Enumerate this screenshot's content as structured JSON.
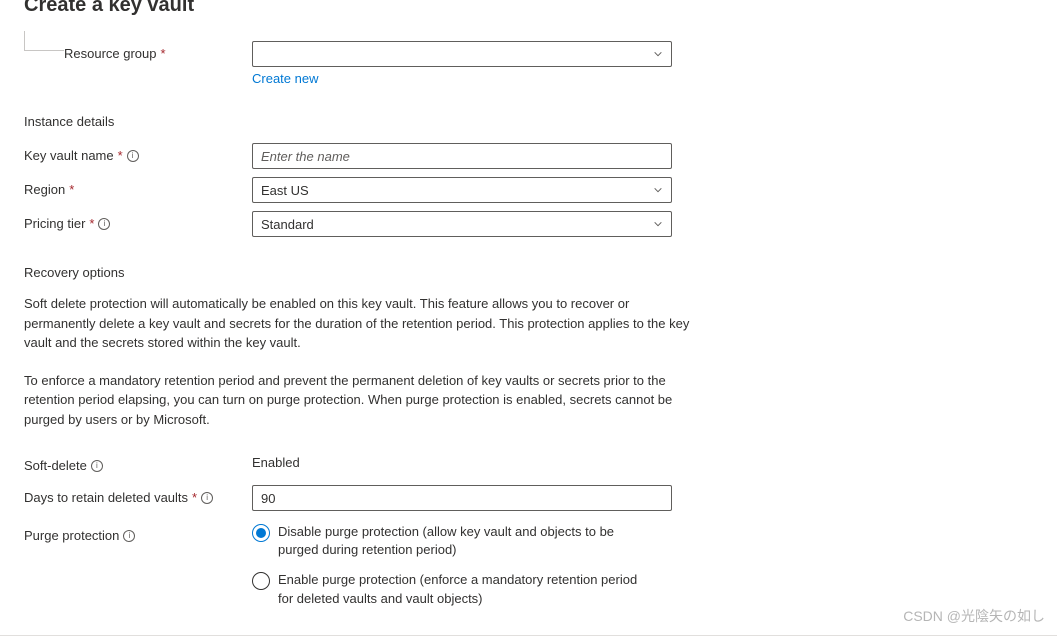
{
  "page": {
    "title": "Create a key vault"
  },
  "resourceGroup": {
    "label": "Resource group",
    "value": "",
    "createNewLink": "Create new"
  },
  "instanceDetails": {
    "heading": "Instance details",
    "keyVaultName": {
      "label": "Key vault name",
      "placeholder": "Enter the name",
      "value": ""
    },
    "region": {
      "label": "Region",
      "value": "East US"
    },
    "pricingTier": {
      "label": "Pricing tier",
      "value": "Standard"
    }
  },
  "recoveryOptions": {
    "heading": "Recovery options",
    "desc1": "Soft delete protection will automatically be enabled on this key vault. This feature allows you to recover or permanently delete a key vault and secrets for the duration of the retention period. This protection applies to the key vault and the secrets stored within the key vault.",
    "desc2": "To enforce a mandatory retention period and prevent the permanent deletion of key vaults or secrets prior to the retention period elapsing, you can turn on purge protection. When purge protection is enabled, secrets cannot be purged by users or by Microsoft.",
    "softDelete": {
      "label": "Soft-delete",
      "value": "Enabled"
    },
    "daysToRetain": {
      "label": "Days to retain deleted vaults",
      "value": "90"
    },
    "purgeProtection": {
      "label": "Purge protection",
      "options": [
        {
          "label": "Disable purge protection (allow key vault and objects to be purged during retention period)",
          "selected": true
        },
        {
          "label": "Enable purge protection (enforce a mandatory retention period for deleted vaults and vault objects)",
          "selected": false
        }
      ]
    }
  },
  "watermark": "CSDN @光陰矢の如し"
}
